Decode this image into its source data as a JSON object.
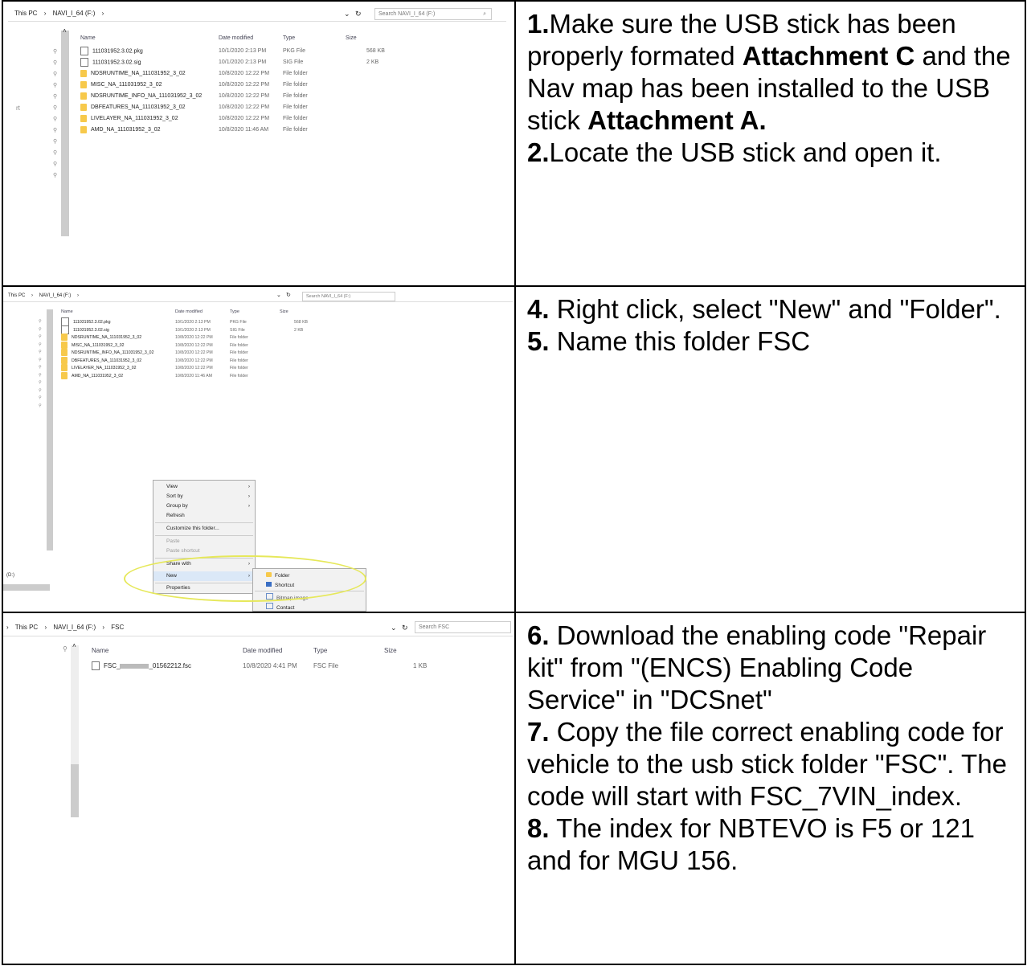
{
  "rows": [
    {
      "explorer": {
        "breadcrumb": [
          "This PC",
          "›",
          "NAVI_I_64 (F:)",
          "›"
        ],
        "search_placeholder": "Search NAVI_I_64 (F:)",
        "columns": [
          "Name",
          "Date modified",
          "Type",
          "Size"
        ],
        "files": [
          {
            "name": "111031952.3.02.pkg",
            "date": "10/1/2020 2:13 PM",
            "type": "PKG File",
            "size": "568 KB",
            "kind": "file"
          },
          {
            "name": "111031952.3.02.sig",
            "date": "10/1/2020 2:13 PM",
            "type": "SIG File",
            "size": "2 KB",
            "kind": "file"
          },
          {
            "name": "NDSRUNTIME_NA_111031952_3_02",
            "date": "10/8/2020 12:22 PM",
            "type": "File folder",
            "size": "",
            "kind": "folder"
          },
          {
            "name": "MISC_NA_111031952_3_02",
            "date": "10/8/2020 12:22 PM",
            "type": "File folder",
            "size": "",
            "kind": "folder"
          },
          {
            "name": "NDSRUNTIME_INFO_NA_111031952_3_02",
            "date": "10/8/2020 12:22 PM",
            "type": "File folder",
            "size": "",
            "kind": "folder"
          },
          {
            "name": "DBFEATURES_NA_111031952_3_02",
            "date": "10/8/2020 12:22 PM",
            "type": "File folder",
            "size": "",
            "kind": "folder"
          },
          {
            "name": "LIVELAYER_NA_111031952_3_02",
            "date": "10/8/2020 12:22 PM",
            "type": "File folder",
            "size": "",
            "kind": "folder"
          },
          {
            "name": "AMD_NA_111031952_3_02",
            "date": "10/8/2020 11:46 AM",
            "type": "File folder",
            "size": "",
            "kind": "folder"
          }
        ]
      },
      "instructions": [
        {
          "num": "1.",
          "parts": [
            "Make sure the USB stick has been properly formated ",
            "Attachment C",
            " and the Nav map has been installed to the USB stick ",
            "Attachment A."
          ]
        },
        {
          "num": "2.",
          "text": "Locate the USB stick and open it."
        }
      ]
    },
    {
      "explorer": {
        "breadcrumb": [
          "This PC",
          "›",
          "NAVI_I_64 (F:)",
          "›"
        ],
        "search_placeholder": "Search NAVI_I_64 (F:)",
        "sidebar_drive": "(D:)",
        "context_menu": [
          "View",
          "Sort by",
          "Group by",
          "Refresh",
          "Customize this folder...",
          "Paste",
          "Paste shortcut",
          "Share with",
          "New",
          "Properties"
        ],
        "submenu": [
          "Folder",
          "Shortcut",
          "Bitmap image",
          "Contact"
        ]
      },
      "instructions": [
        {
          "num": "4.",
          "text": " Right click, select \"New\" and \"Folder\"."
        },
        {
          "num": "5.",
          "text": " Name this folder FSC"
        }
      ]
    },
    {
      "explorer": {
        "breadcrumb": [
          "›",
          "This PC",
          "›",
          "NAVI_I_64 (F:)",
          "›",
          "FSC"
        ],
        "search_placeholder": "Search FSC",
        "columns": [
          "Name",
          "Date modified",
          "Type",
          "Size"
        ],
        "files": [
          {
            "name_prefix": "FSC_",
            "name_suffix": "_01562212.fsc",
            "date": "10/8/2020 4:41 PM",
            "type": "FSC File",
            "size": "1 KB"
          }
        ]
      },
      "instructions": [
        {
          "num": "6.",
          "text": " Download the enabling code \"Repair kit\" from \"(ENCS) Enabling Code Service\" in \"DCSnet\""
        },
        {
          "num": "7.",
          "text": " Copy the file correct enabling code for vehicle to the usb stick folder \"FSC\". The code will start with FSC_7VIN_index."
        },
        {
          "num": "8.",
          "text": " The index for NBTEVO is F5 or 121 and for MGU 156."
        }
      ]
    }
  ],
  "colors": {
    "folder": "#f7c94b",
    "highlight_oval": "#e6e85a",
    "border": "#000000"
  },
  "icons": [
    "folder-icon",
    "file-icon",
    "pin-icon",
    "refresh-icon",
    "search-icon"
  ]
}
